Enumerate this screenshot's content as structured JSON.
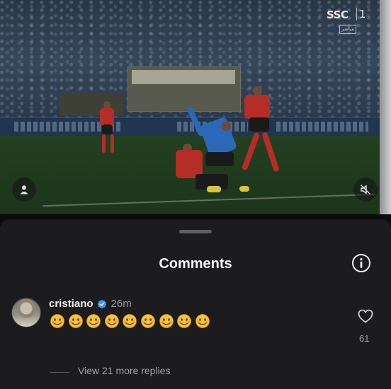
{
  "video": {
    "channel_logo": "SSC",
    "channel_number": "1",
    "live_badge": "مباشر",
    "icons": {
      "profile": "person-icon",
      "mute": "speaker-muted-icon"
    }
  },
  "comments_sheet": {
    "title": "Comments",
    "info_icon": "info-circle-icon",
    "comment": {
      "username": "cristiano",
      "verified": true,
      "time": "26m",
      "text": "🫠🫠🫠🫠🫠🫠🫠🫠🫠",
      "emoji_count": 9,
      "like_count": "61",
      "view_replies": "View 21 more replies"
    }
  },
  "colors": {
    "sheet_background": "#1c1c1e",
    "verified_badge": "#3897f0",
    "emoji_yellow": "#f6c23c"
  }
}
